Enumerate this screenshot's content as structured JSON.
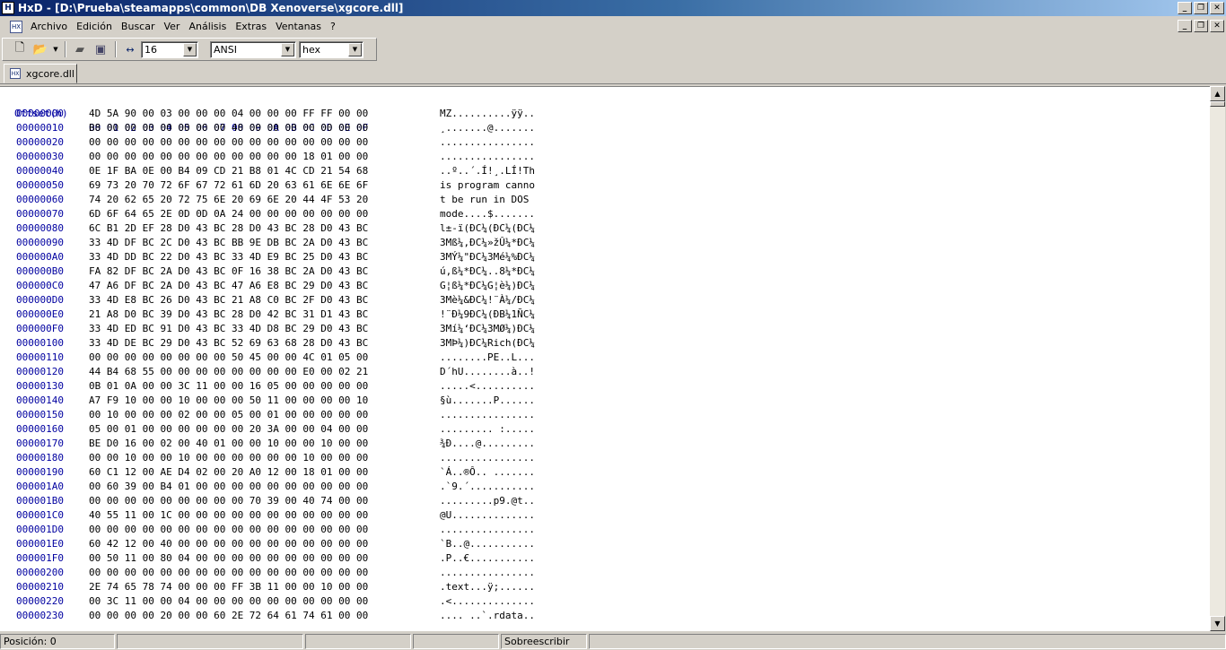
{
  "window": {
    "title": "HxD - [D:\\Prueba\\steamapps\\common\\DB Xenoverse\\xgcore.dll]",
    "app_icon": "HxD-app-icon"
  },
  "menu": [
    "Archivo",
    "Edición",
    "Buscar",
    "Ver",
    "Análisis",
    "Extras",
    "Ventanas",
    "?"
  ],
  "toolbar": {
    "bytes_per_row": "16",
    "charset": "ANSI",
    "offset_base": "hex"
  },
  "tab": {
    "label": "xgcore.dll"
  },
  "editor": {
    "header_offset": "Offset(h)",
    "header_columns": "00 01 02 03 04 05 06 07 08 09 0A 0B 0C 0D 0E 0F",
    "rows": [
      {
        "off": "00000000",
        "hex": "4D 5A 90 00 03 00 00 00 04 00 00 00 FF FF 00 00",
        "ascii": "MZ..........ÿÿ.."
      },
      {
        "off": "00000010",
        "hex": "B8 00 00 00 00 00 00 00 40 00 00 00 00 00 00 00",
        "ascii": "¸.......@......."
      },
      {
        "off": "00000020",
        "hex": "00 00 00 00 00 00 00 00 00 00 00 00 00 00 00 00",
        "ascii": "................"
      },
      {
        "off": "00000030",
        "hex": "00 00 00 00 00 00 00 00 00 00 00 00 18 01 00 00",
        "ascii": "................"
      },
      {
        "off": "00000040",
        "hex": "0E 1F BA 0E 00 B4 09 CD 21 B8 01 4C CD 21 54 68",
        "ascii": "..º..´.Í!¸.LÍ!Th"
      },
      {
        "off": "00000050",
        "hex": "69 73 20 70 72 6F 67 72 61 6D 20 63 61 6E 6E 6F",
        "ascii": "is program canno"
      },
      {
        "off": "00000060",
        "hex": "74 20 62 65 20 72 75 6E 20 69 6E 20 44 4F 53 20",
        "ascii": "t be run in DOS "
      },
      {
        "off": "00000070",
        "hex": "6D 6F 64 65 2E 0D 0D 0A 24 00 00 00 00 00 00 00",
        "ascii": "mode....$......."
      },
      {
        "off": "00000080",
        "hex": "6C B1 2D EF 28 D0 43 BC 28 D0 43 BC 28 D0 43 BC",
        "ascii": "l±-ï(ÐC¼(ÐC¼(ÐC¼"
      },
      {
        "off": "00000090",
        "hex": "33 4D DF BC 2C D0 43 BC BB 9E DB BC 2A D0 43 BC",
        "ascii": "3Mß¼,ÐC¼»žÛ¼*ÐC¼"
      },
      {
        "off": "000000A0",
        "hex": "33 4D DD BC 22 D0 43 BC 33 4D E9 BC 25 D0 43 BC",
        "ascii": "3MÝ¼\"ÐC¼3Mé¼%ÐC¼"
      },
      {
        "off": "000000B0",
        "hex": "FA 82 DF BC 2A D0 43 BC 0F 16 38 BC 2A D0 43 BC",
        "ascii": "ú‚ß¼*ÐC¼..8¼*ÐC¼"
      },
      {
        "off": "000000C0",
        "hex": "47 A6 DF BC 2A D0 43 BC 47 A6 E8 BC 29 D0 43 BC",
        "ascii": "G¦ß¼*ÐC¼G¦è¼)ÐC¼"
      },
      {
        "off": "000000D0",
        "hex": "33 4D E8 BC 26 D0 43 BC 21 A8 C0 BC 2F D0 43 BC",
        "ascii": "3Mè¼&ÐC¼!¨À¼/ÐC¼"
      },
      {
        "off": "000000E0",
        "hex": "21 A8 D0 BC 39 D0 43 BC 28 D0 42 BC 31 D1 43 BC",
        "ascii": "!¨Ð¼9ÐC¼(ÐB¼1ÑC¼"
      },
      {
        "off": "000000F0",
        "hex": "33 4D ED BC 91 D0 43 BC 33 4D D8 BC 29 D0 43 BC",
        "ascii": "3Mí¼‘ÐC¼3MØ¼)ÐC¼"
      },
      {
        "off": "00000100",
        "hex": "33 4D DE BC 29 D0 43 BC 52 69 63 68 28 D0 43 BC",
        "ascii": "3MÞ¼)ÐC¼Rich(ÐC¼"
      },
      {
        "off": "00000110",
        "hex": "00 00 00 00 00 00 00 00 50 45 00 00 4C 01 05 00",
        "ascii": "........PE..L..."
      },
      {
        "off": "00000120",
        "hex": "44 B4 68 55 00 00 00 00 00 00 00 00 E0 00 02 21",
        "ascii": "D´hU........à..!"
      },
      {
        "off": "00000130",
        "hex": "0B 01 0A 00 00 3C 11 00 00 16 05 00 00 00 00 00",
        "ascii": ".....<.........."
      },
      {
        "off": "00000140",
        "hex": "A7 F9 10 00 00 10 00 00 00 50 11 00 00 00 00 10",
        "ascii": "§ù.......P......"
      },
      {
        "off": "00000150",
        "hex": "00 10 00 00 00 02 00 00 05 00 01 00 00 00 00 00",
        "ascii": "................"
      },
      {
        "off": "00000160",
        "hex": "05 00 01 00 00 00 00 00 00 20 3A 00 00 04 00 00",
        "ascii": "......... :....."
      },
      {
        "off": "00000170",
        "hex": "BE D0 16 00 02 00 40 01 00 00 10 00 00 10 00 00",
        "ascii": "¾Ð....@........."
      },
      {
        "off": "00000180",
        "hex": "00 00 10 00 00 10 00 00 00 00 00 00 10 00 00 00",
        "ascii": "................"
      },
      {
        "off": "00000190",
        "hex": "60 C1 12 00 AE D4 02 00 20 A0 12 00 18 01 00 00",
        "ascii": "`Á..®Ô.. ......."
      },
      {
        "off": "000001A0",
        "hex": "00 60 39 00 B4 01 00 00 00 00 00 00 00 00 00 00",
        "ascii": ".`9.´..........."
      },
      {
        "off": "000001B0",
        "hex": "00 00 00 00 00 00 00 00 00 70 39 00 40 74 00 00",
        "ascii": ".........p9.@t.."
      },
      {
        "off": "000001C0",
        "hex": "40 55 11 00 1C 00 00 00 00 00 00 00 00 00 00 00",
        "ascii": "@U.............."
      },
      {
        "off": "000001D0",
        "hex": "00 00 00 00 00 00 00 00 00 00 00 00 00 00 00 00",
        "ascii": "................"
      },
      {
        "off": "000001E0",
        "hex": "60 42 12 00 40 00 00 00 00 00 00 00 00 00 00 00",
        "ascii": "`B..@..........."
      },
      {
        "off": "000001F0",
        "hex": "00 50 11 00 80 04 00 00 00 00 00 00 00 00 00 00",
        "ascii": ".P..€..........."
      },
      {
        "off": "00000200",
        "hex": "00 00 00 00 00 00 00 00 00 00 00 00 00 00 00 00",
        "ascii": "................"
      },
      {
        "off": "00000210",
        "hex": "2E 74 65 78 74 00 00 00 FF 3B 11 00 00 10 00 00",
        "ascii": ".text...ÿ;......"
      },
      {
        "off": "00000220",
        "hex": "00 3C 11 00 00 04 00 00 00 00 00 00 00 00 00 00",
        "ascii": ".<.............."
      },
      {
        "off": "00000230",
        "hex": "00 00 00 00 20 00 00 60 2E 72 64 61 74 61 00 00",
        "ascii": ".... ..`.rdata.."
      }
    ]
  },
  "status": {
    "position": "Posición: 0",
    "mode": "Sobreescribir"
  },
  "colors": {
    "offset_blue": "#0000a0",
    "title_start": "#0a246a",
    "title_end": "#a6caf0"
  }
}
